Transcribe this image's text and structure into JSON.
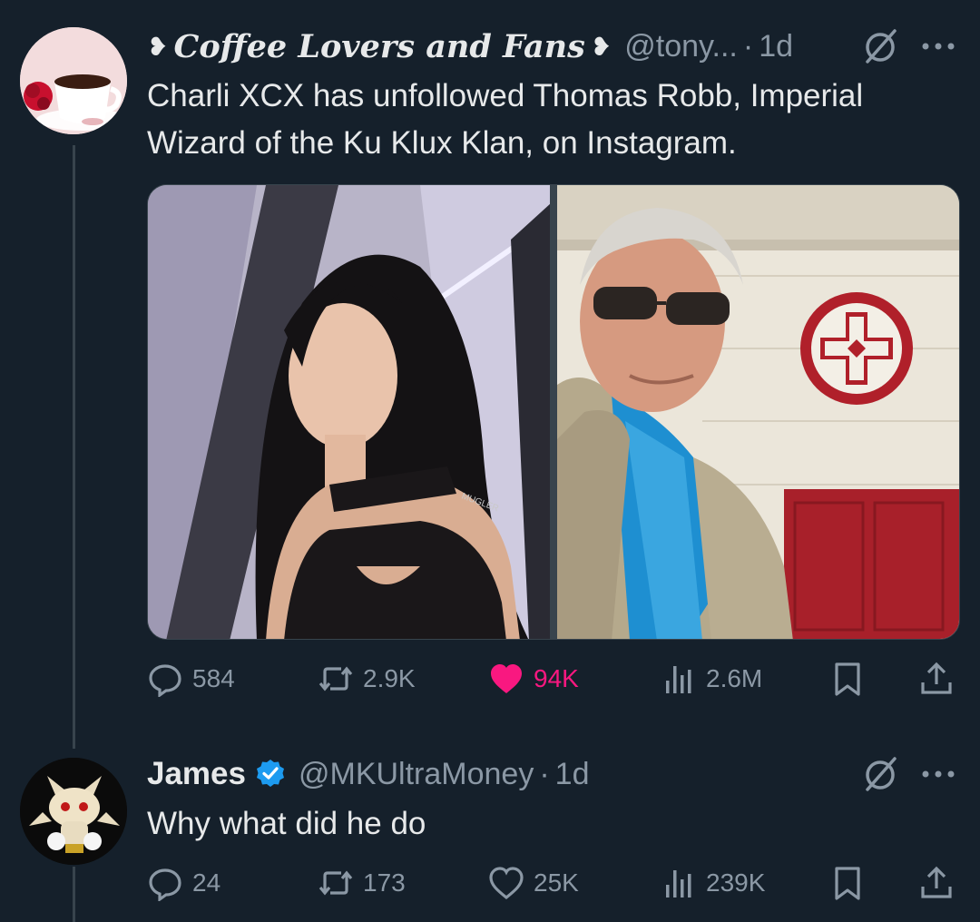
{
  "tweet": {
    "display_name": "Coffee Lovers and Fans",
    "handle": "@tony...",
    "separator": "·",
    "time": "1d",
    "text": "Charli XCX has unfollowed Thomas Robb, Imperial Wizard of the Ku Klux Klan, on Instagram.",
    "media": [
      {
        "description_icon": "photo-charli-xcx",
        "watermark": "MUGLER"
      },
      {
        "description_icon": "photo-thomas-robb"
      }
    ],
    "actions": {
      "replies": "584",
      "reposts": "2.9K",
      "likes": "94K",
      "views": "2.6M"
    },
    "liked": true
  },
  "reply": {
    "display_name": "James",
    "handle": "@MKUltraMoney",
    "separator": "·",
    "time": "1d",
    "text": "Why what did he do",
    "actions": {
      "replies": "24",
      "reposts": "173",
      "likes": "25K",
      "views": "239K"
    },
    "liked": false
  },
  "colors": {
    "background": "#15202b",
    "text": "#e7e9ea",
    "muted": "#8b98a5",
    "like": "#f91880",
    "verified": "#1d9bf0"
  },
  "icons": [
    "reply-icon",
    "repost-icon",
    "like-icon",
    "views-icon",
    "bookmark-icon",
    "share-icon",
    "grok-icon",
    "more-icon",
    "verified-badge-icon"
  ]
}
